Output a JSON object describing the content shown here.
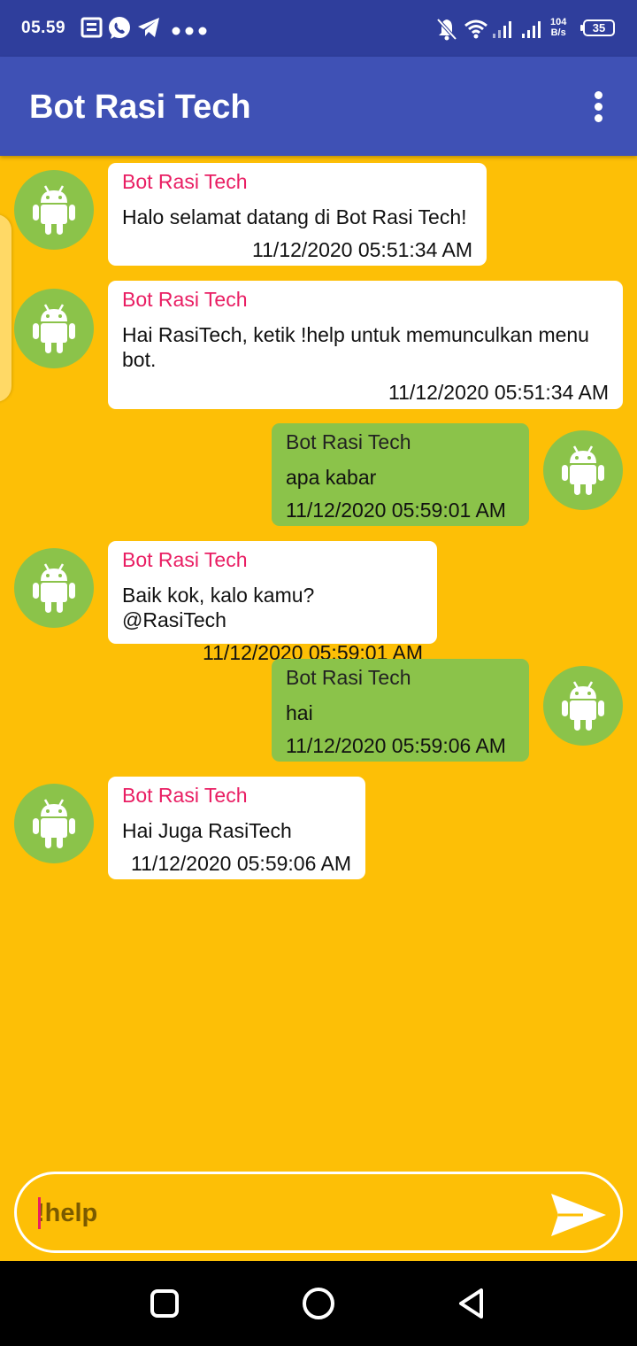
{
  "status_bar": {
    "time": "05.59",
    "speed_value": "104",
    "speed_unit": "B/s",
    "battery": "35",
    "left_icons": [
      "news-icon",
      "whatsapp-icon",
      "telegram-icon",
      "more-notifications-icon"
    ],
    "right_icons": [
      "bell-off-icon",
      "wifi-icon",
      "signal-icon",
      "signal-icon"
    ]
  },
  "app_bar": {
    "title": "Bot Rasi Tech",
    "menu_icon": "overflow-menu-icon"
  },
  "messages": [
    {
      "side": "left",
      "sender": "Bot Rasi Tech",
      "text": "Halo selamat datang di Bot Rasi Tech!",
      "time": "11/12/2020 05:51:34 AM"
    },
    {
      "side": "left",
      "sender": "Bot Rasi Tech",
      "text": "Hai RasiTech, ketik !help untuk memunculkan menu bot.",
      "time": "11/12/2020 05:51:34 AM"
    },
    {
      "side": "right",
      "sender": "Bot Rasi Tech",
      "text": "apa kabar",
      "time": "11/12/2020 05:59:01 AM"
    },
    {
      "side": "left",
      "sender": "Bot Rasi Tech",
      "text": "Baik kok, kalo kamu? @RasiTech",
      "time": "11/12/2020 05:59:01 AM"
    },
    {
      "side": "right",
      "sender": "Bot Rasi Tech",
      "text": "hai",
      "time": "11/12/2020 05:59:06 AM"
    },
    {
      "side": "left",
      "sender": "Bot Rasi Tech",
      "text": "Hai Juga RasiTech",
      "time": "11/12/2020 05:59:06 AM"
    }
  ],
  "input": {
    "value": "!help",
    "send_icon": "send-icon"
  },
  "nav_bar": {
    "icons": [
      "recents-icon",
      "home-icon",
      "back-icon"
    ]
  },
  "colors": {
    "status_bar": "#2F3E9C",
    "app_bar": "#3F51B5",
    "chat_background": "#FDBF06",
    "bubble_incoming": "#FFFFFF",
    "bubble_outgoing": "#8BC34A",
    "sender_incoming": "#E91E63"
  }
}
